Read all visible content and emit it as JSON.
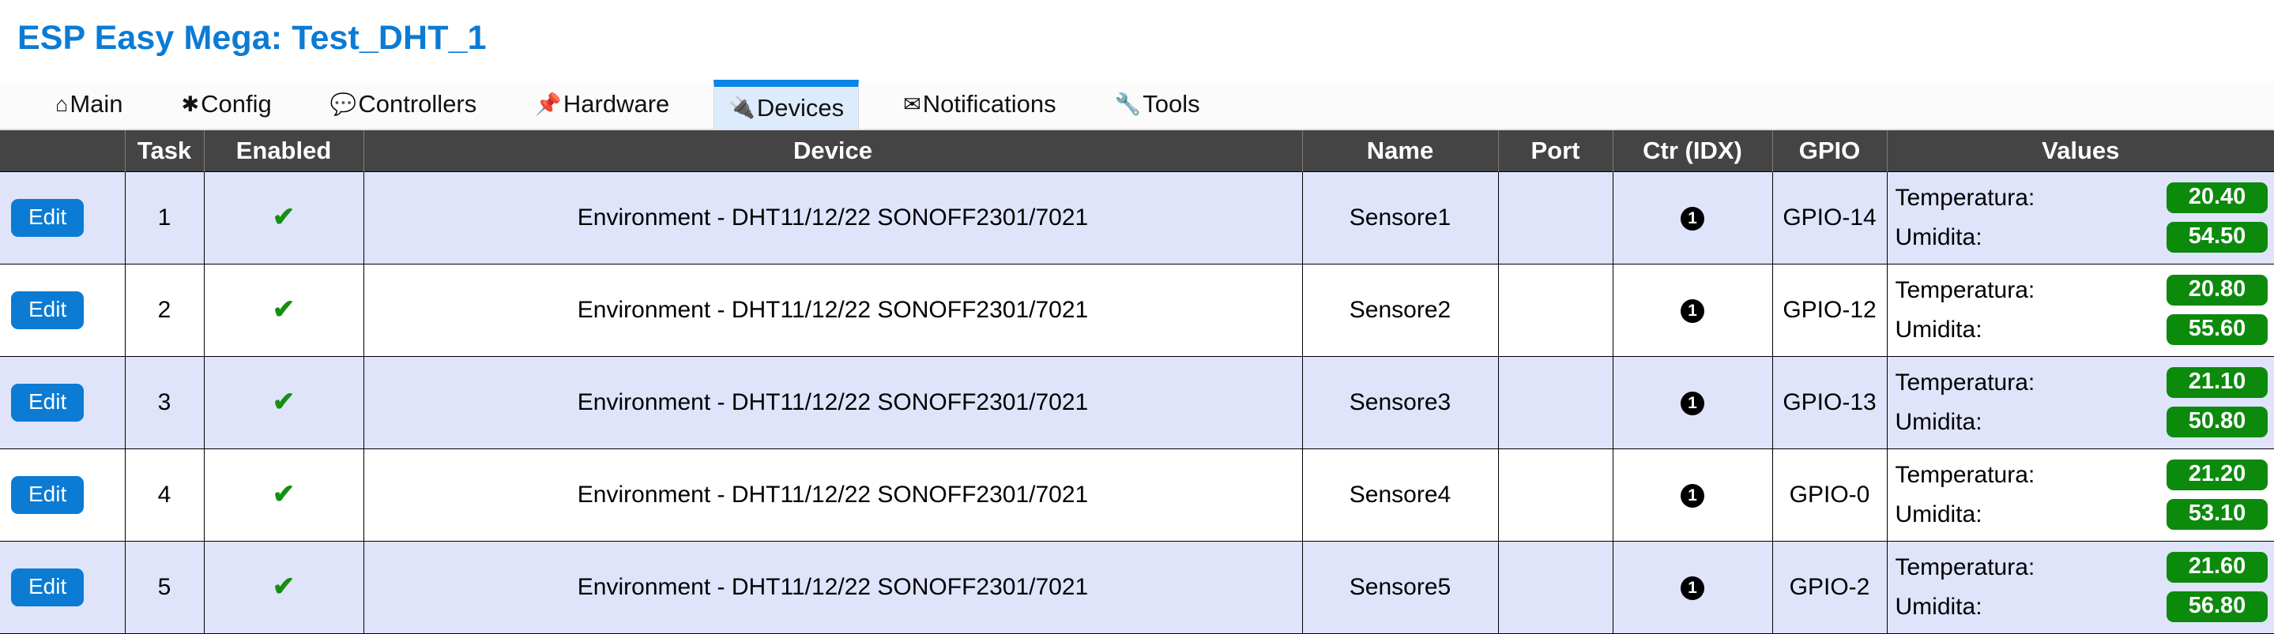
{
  "header": {
    "title": "ESP Easy Mega: Test_DHT_1",
    "title_color": "#0b7bd4"
  },
  "tabs": [
    {
      "id": "main",
      "icon": "home-icon",
      "glyph": "⌂",
      "label": "Main",
      "active": false
    },
    {
      "id": "config",
      "icon": "gear-icon",
      "glyph": "✱",
      "label": "Config",
      "active": false
    },
    {
      "id": "controllers",
      "icon": "speech-bubble-icon",
      "glyph": "💬",
      "label": "Controllers",
      "active": false
    },
    {
      "id": "hardware",
      "icon": "pushpin-icon",
      "glyph": "📌",
      "label": "Hardware",
      "active": false
    },
    {
      "id": "devices",
      "icon": "plug-icon",
      "glyph": "🔌",
      "label": "Devices",
      "active": true
    },
    {
      "id": "notifications",
      "icon": "envelope-icon",
      "glyph": "✉",
      "label": "Notifications",
      "active": false
    },
    {
      "id": "tools",
      "icon": "wrench-icon",
      "glyph": "🔧",
      "label": "Tools",
      "active": false
    }
  ],
  "table": {
    "columns": [
      {
        "key": "edit",
        "label": ""
      },
      {
        "key": "task",
        "label": "Task"
      },
      {
        "key": "enabled",
        "label": "Enabled"
      },
      {
        "key": "device",
        "label": "Device"
      },
      {
        "key": "name",
        "label": "Name"
      },
      {
        "key": "port",
        "label": "Port"
      },
      {
        "key": "ctr",
        "label": "Ctr (IDX)"
      },
      {
        "key": "gpio",
        "label": "GPIO"
      },
      {
        "key": "values",
        "label": "Values"
      }
    ],
    "edit_label": "Edit",
    "enabled_glyph": "✔",
    "ctr_glyph": "1",
    "rows": [
      {
        "task": "1",
        "enabled": true,
        "device": "Environment - DHT11/12/22 SONOFF2301/7021",
        "name": "Sensore1",
        "port": "",
        "ctr": "1",
        "gpio": "GPIO-14",
        "values": [
          {
            "label": "Temperatura:",
            "value": "20.40"
          },
          {
            "label": "Umidita:",
            "value": "54.50"
          }
        ]
      },
      {
        "task": "2",
        "enabled": true,
        "device": "Environment - DHT11/12/22 SONOFF2301/7021",
        "name": "Sensore2",
        "port": "",
        "ctr": "1",
        "gpio": "GPIO-12",
        "values": [
          {
            "label": "Temperatura:",
            "value": "20.80"
          },
          {
            "label": "Umidita:",
            "value": "55.60"
          }
        ]
      },
      {
        "task": "3",
        "enabled": true,
        "device": "Environment - DHT11/12/22 SONOFF2301/7021",
        "name": "Sensore3",
        "port": "",
        "ctr": "1",
        "gpio": "GPIO-13",
        "values": [
          {
            "label": "Temperatura:",
            "value": "21.10"
          },
          {
            "label": "Umidita:",
            "value": "50.80"
          }
        ]
      },
      {
        "task": "4",
        "enabled": true,
        "device": "Environment - DHT11/12/22 SONOFF2301/7021",
        "name": "Sensore4",
        "port": "",
        "ctr": "1",
        "gpio": "GPIO-0",
        "values": [
          {
            "label": "Temperatura:",
            "value": "21.20"
          },
          {
            "label": "Umidita:",
            "value": "53.10"
          }
        ]
      },
      {
        "task": "5",
        "enabled": true,
        "device": "Environment - DHT11/12/22 SONOFF2301/7021",
        "name": "Sensore5",
        "port": "",
        "ctr": "1",
        "gpio": "GPIO-2",
        "values": [
          {
            "label": "Temperatura:",
            "value": "21.60"
          },
          {
            "label": "Umidita:",
            "value": "56.80"
          }
        ]
      }
    ]
  },
  "colors": {
    "header_row_bg": "#444444",
    "tab_active_bg": "#ddecfd",
    "tab_active_accent": "#0b84e8",
    "edit_button_bg": "#0b7bd4",
    "value_badge_bg": "#0c8a0c",
    "enabled_check": "#159010",
    "row_alt_bg": "#dfe4fb"
  }
}
